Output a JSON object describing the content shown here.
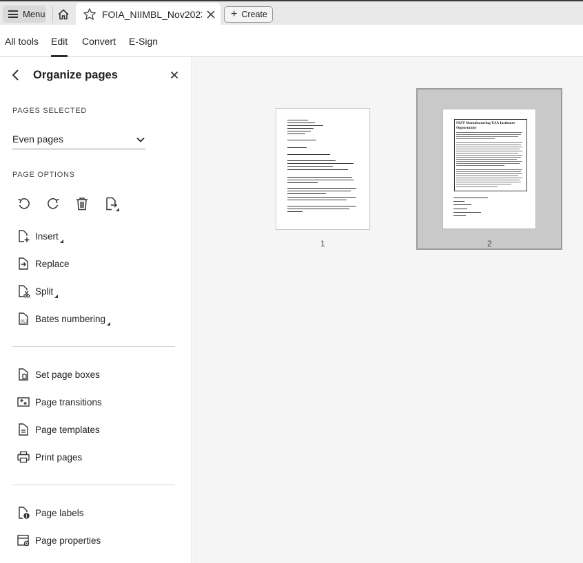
{
  "tabbar": {
    "menu_label": "Menu",
    "doc_title": "FOIA_NIIMBL_Nov2023...",
    "create_label": "Create"
  },
  "tooltabs": [
    "All tools",
    "Edit",
    "Convert",
    "E-Sign"
  ],
  "active_tab": "Edit",
  "panel": {
    "title": "Organize pages",
    "pages_selected_label": "PAGES SELECTED",
    "selection_value": "Even pages",
    "page_options_label": "PAGE OPTIONS",
    "option_icons": [
      "rotate-left-icon",
      "rotate-right-icon",
      "delete-icon",
      "extract-icon"
    ],
    "items_group1": [
      {
        "label": "Insert",
        "icon": "insert-page-icon",
        "flyout": true
      },
      {
        "label": "Replace",
        "icon": "replace-page-icon",
        "flyout": false
      },
      {
        "label": "Split",
        "icon": "split-icon",
        "flyout": true
      },
      {
        "label": "Bates numbering",
        "icon": "bates-numbering-icon",
        "flyout": true
      }
    ],
    "items_group2": [
      {
        "label": "Set page boxes",
        "icon": "page-boxes-icon"
      },
      {
        "label": "Page transitions",
        "icon": "page-transitions-icon"
      },
      {
        "label": "Page templates",
        "icon": "page-templates-icon"
      },
      {
        "label": "Print pages",
        "icon": "printer-icon"
      }
    ],
    "items_group3": [
      {
        "label": "Page labels",
        "icon": "page-labels-icon"
      },
      {
        "label": "Page properties",
        "icon": "page-properties-icon"
      }
    ]
  },
  "pages": [
    {
      "number": "1",
      "selected": false
    },
    {
      "number": "2",
      "selected": true
    }
  ],
  "page2_heading": "NIST Manufacturing USA Institutes Opportunity",
  "colors": {
    "selection_bg": "#c9c9c9",
    "canvas_bg": "#f5f5f5"
  }
}
